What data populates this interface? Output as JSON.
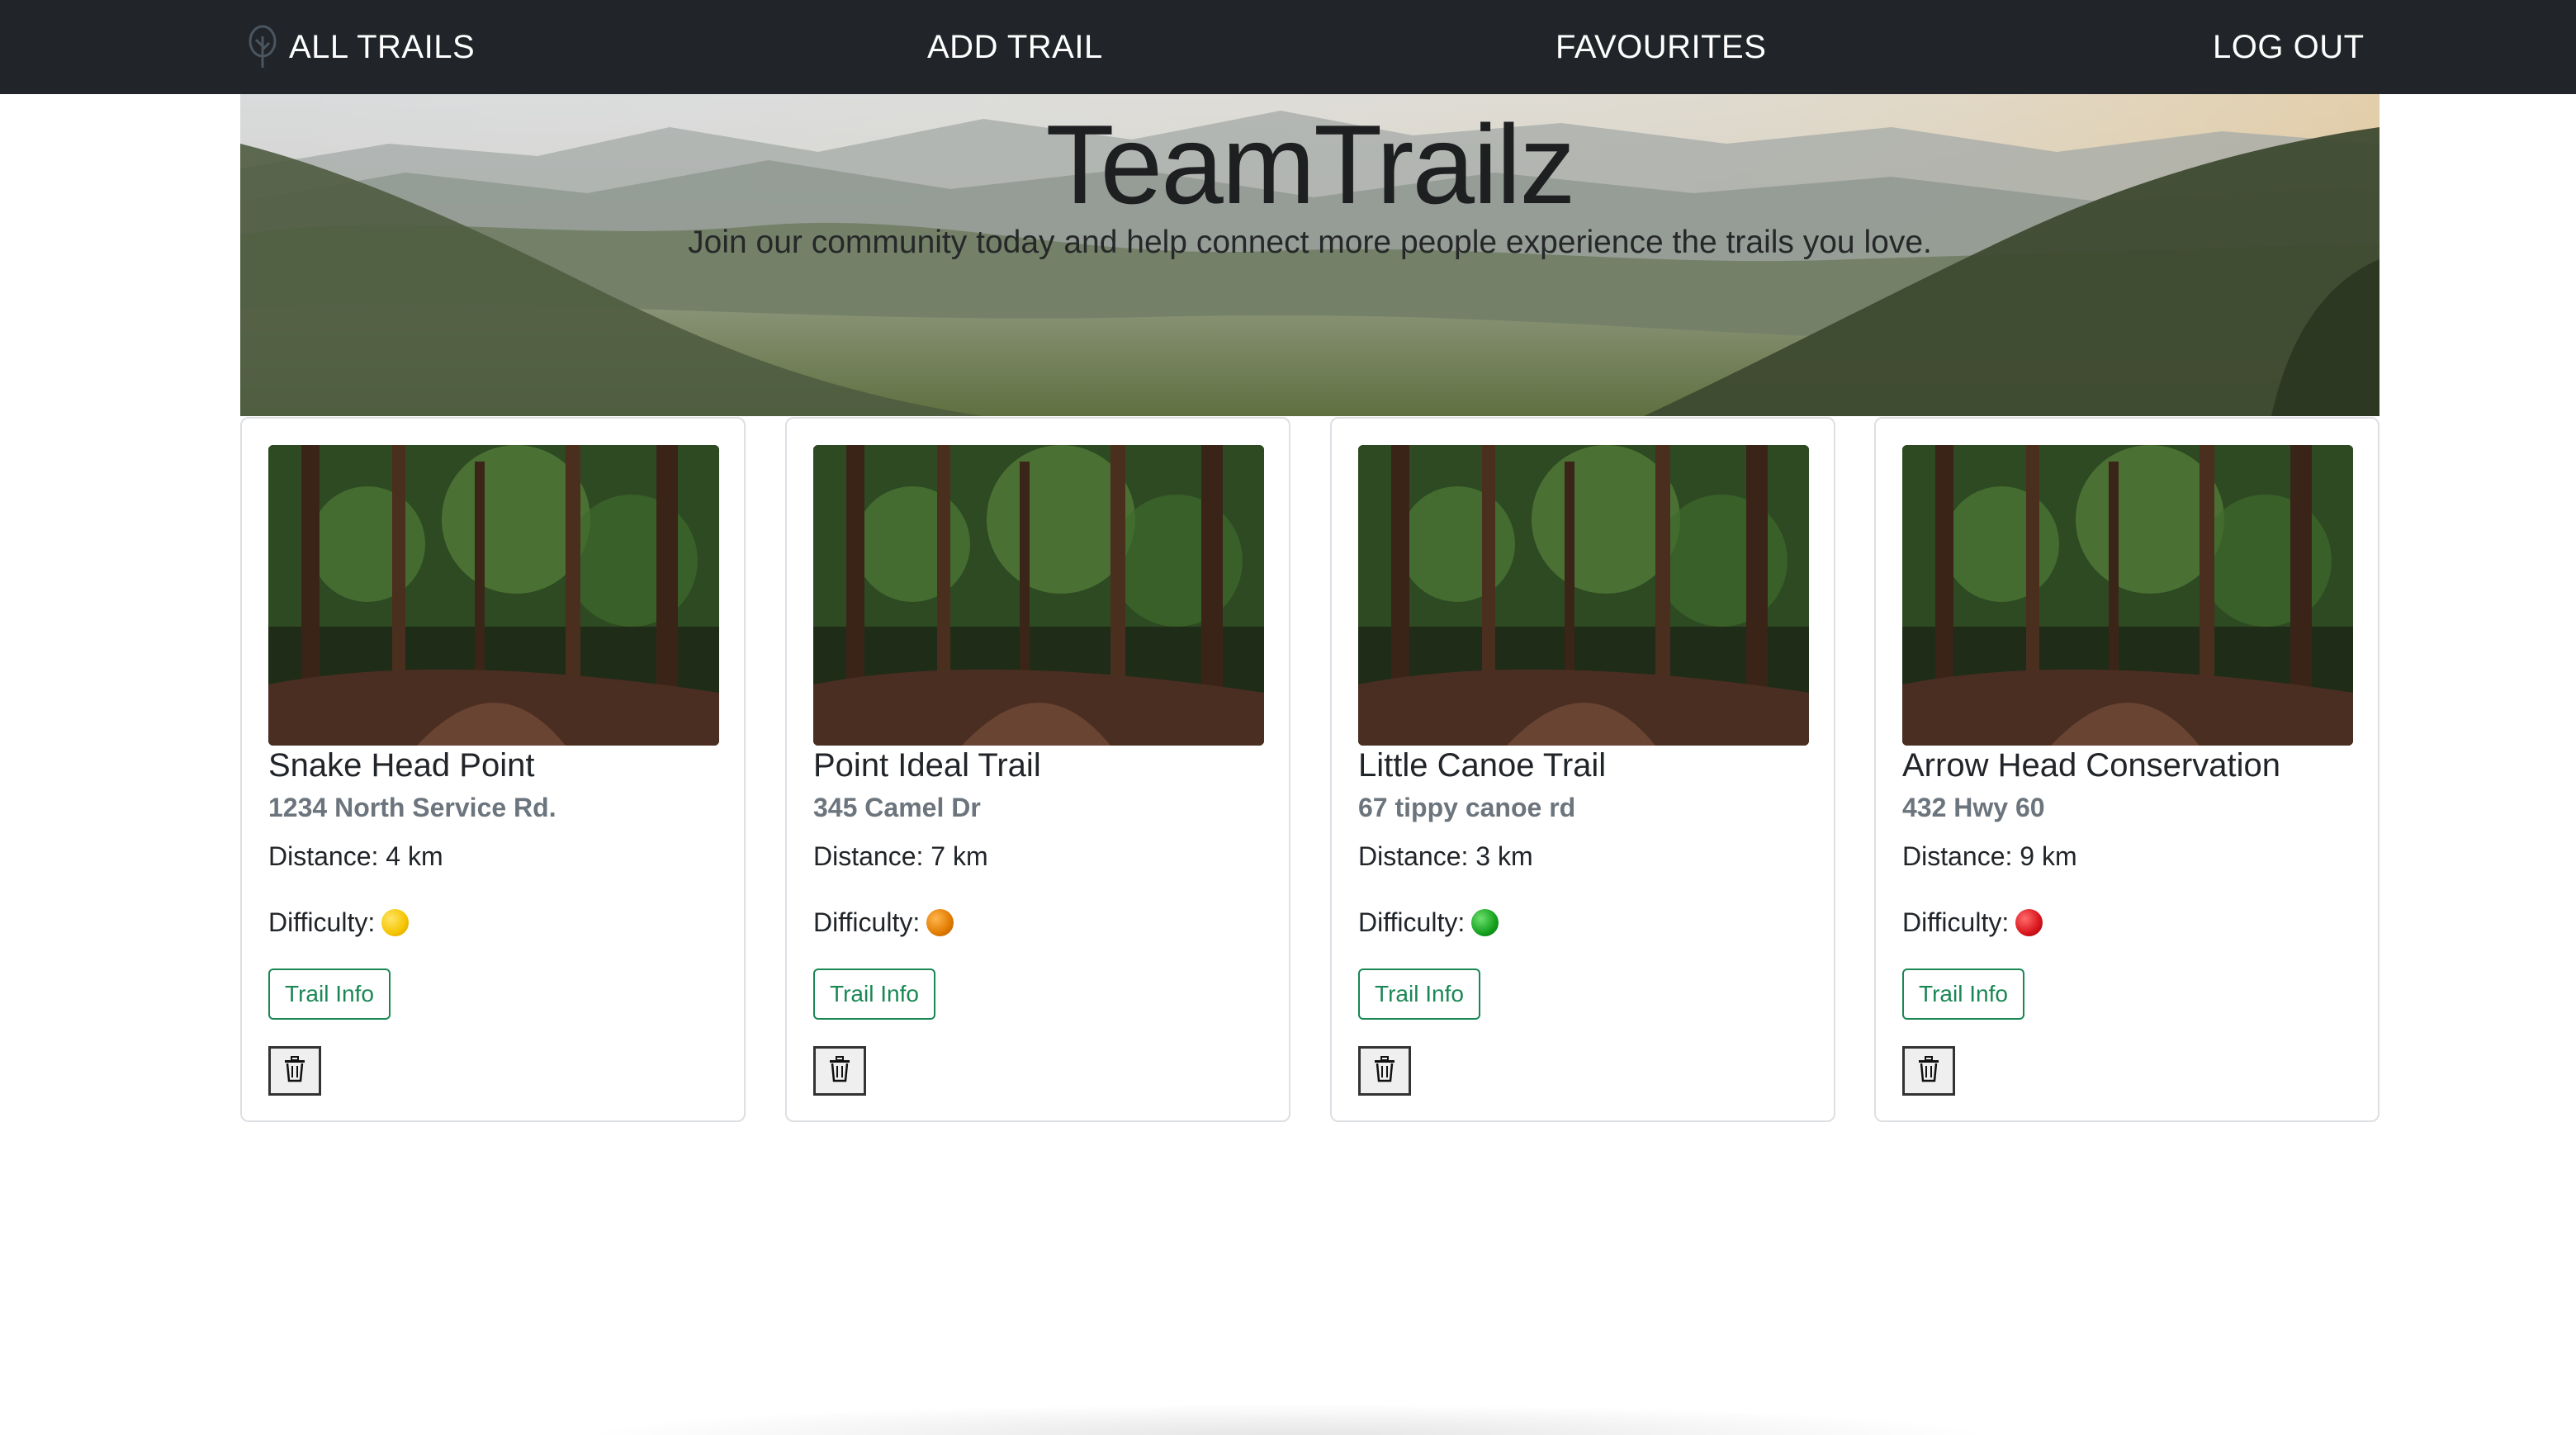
{
  "navbar": {
    "brand_label": "ALL TRAILS",
    "brand_icon": "tree-icon",
    "add_trail_label": "ADD TRAIL",
    "favourites_label": "FAVOURITES",
    "logout_label": "LOG OUT",
    "background_color": "#212529"
  },
  "hero": {
    "title": "TeamTrailz",
    "subtitle": "Join our community today and help connect more people experience the trails you love."
  },
  "cards": [
    {
      "title": "Snake Head Point",
      "address": "1234 North Service Rd.",
      "distance": "Distance: 4 km",
      "difficulty_label": "Difficulty:",
      "difficulty_color": "#f5c400",
      "button_label": "Trail Info",
      "delete_icon": "trash-icon"
    },
    {
      "title": "Point Ideal Trail",
      "address": "345 Camel Dr",
      "distance": "Distance: 7 km",
      "difficulty_label": "Difficulty:",
      "difficulty_color": "#e07b00",
      "button_label": "Trail Info",
      "delete_icon": "trash-icon"
    },
    {
      "title": "Little Canoe Trail",
      "address": "67 tippy canoe rd",
      "distance": "Distance: 3 km",
      "difficulty_label": "Difficulty:",
      "difficulty_color": "#14a01e",
      "button_label": "Trail Info",
      "delete_icon": "trash-icon"
    },
    {
      "title": "Arrow Head Conservation",
      "address": "432 Hwy 60",
      "distance": "Distance: 9 km",
      "difficulty_label": "Difficulty:",
      "difficulty_color": "#d8141c",
      "button_label": "Trail Info",
      "delete_icon": "trash-icon"
    }
  ],
  "colors": {
    "accent_green": "#198754",
    "muted_text": "#6c757d"
  }
}
